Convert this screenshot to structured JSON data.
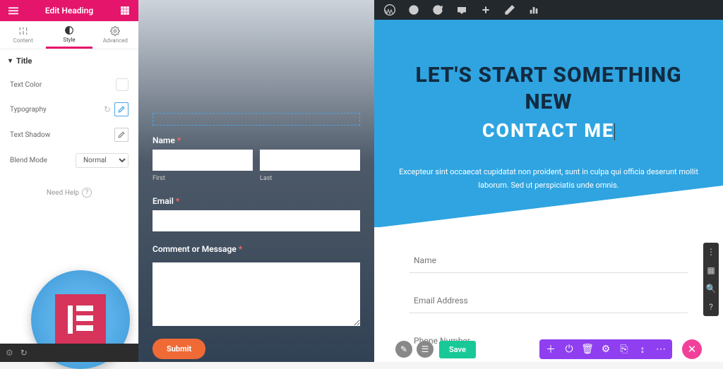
{
  "editor": {
    "header_title": "Edit Heading",
    "tabs": {
      "content": "Content",
      "style": "Style",
      "advanced": "Advanced"
    },
    "section": "Title",
    "controls": {
      "text_color": "Text Color",
      "typography": "Typography",
      "text_shadow": "Text Shadow",
      "blend_mode_label": "Blend Mode",
      "blend_mode_value": "Normal"
    },
    "help": "Need Help"
  },
  "mid_form": {
    "name_label": "Name",
    "first": "First",
    "last": "Last",
    "email_label": "Email",
    "comment_label": "Comment or Message",
    "submit": "Submit"
  },
  "right": {
    "headline": "LET'S START SOMETHING NEW",
    "subhead": "CONTACT ME",
    "para": "Excepteur sint occaecat cupidatat non proident, sunt in culpa qui officia deserunt mollit laborum. Sed ut perspiciatis unde omnis.",
    "fields": {
      "name": "Name",
      "email": "Email Address",
      "phone": "Phone Number"
    },
    "save": "Save"
  }
}
